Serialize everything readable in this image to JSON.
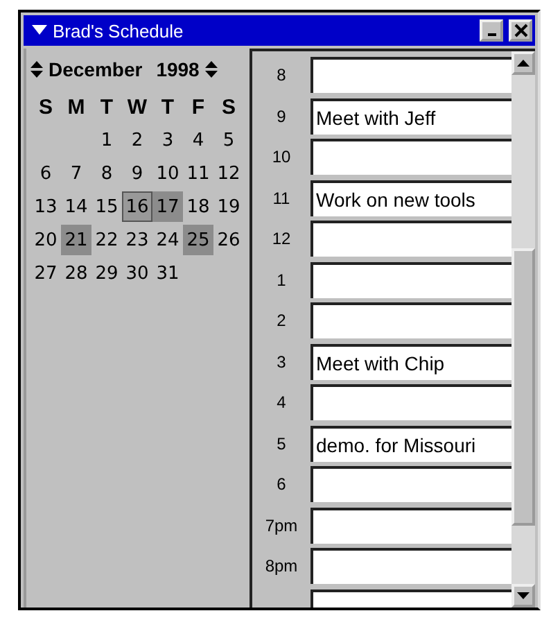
{
  "window": {
    "title": "Brad's Schedule"
  },
  "calendar": {
    "month": "December",
    "year": "1998",
    "weekdays": [
      "S",
      "M",
      "T",
      "W",
      "T",
      "F",
      "S"
    ],
    "days": [
      {
        "label": "1",
        "selected": false,
        "highlighted": false
      },
      {
        "label": "2",
        "selected": false,
        "highlighted": false
      },
      {
        "label": "3",
        "selected": false,
        "highlighted": false
      },
      {
        "label": "4",
        "selected": false,
        "highlighted": false
      },
      {
        "label": "5",
        "selected": false,
        "highlighted": false
      },
      {
        "label": "6",
        "selected": false,
        "highlighted": false
      },
      {
        "label": "7",
        "selected": false,
        "highlighted": false
      },
      {
        "label": "8",
        "selected": false,
        "highlighted": false
      },
      {
        "label": "9",
        "selected": false,
        "highlighted": false
      },
      {
        "label": "10",
        "selected": false,
        "highlighted": false
      },
      {
        "label": "11",
        "selected": false,
        "highlighted": false
      },
      {
        "label": "12",
        "selected": false,
        "highlighted": false
      },
      {
        "label": "13",
        "selected": false,
        "highlighted": false
      },
      {
        "label": "14",
        "selected": false,
        "highlighted": false
      },
      {
        "label": "15",
        "selected": false,
        "highlighted": false
      },
      {
        "label": "16",
        "selected": true,
        "highlighted": true
      },
      {
        "label": "17",
        "selected": false,
        "highlighted": true
      },
      {
        "label": "18",
        "selected": false,
        "highlighted": false
      },
      {
        "label": "19",
        "selected": false,
        "highlighted": false
      },
      {
        "label": "20",
        "selected": false,
        "highlighted": false
      },
      {
        "label": "21",
        "selected": false,
        "highlighted": true
      },
      {
        "label": "22",
        "selected": false,
        "highlighted": false
      },
      {
        "label": "23",
        "selected": false,
        "highlighted": false
      },
      {
        "label": "24",
        "selected": false,
        "highlighted": false
      },
      {
        "label": "25",
        "selected": false,
        "highlighted": true
      },
      {
        "label": "26",
        "selected": false,
        "highlighted": false
      },
      {
        "label": "27",
        "selected": false,
        "highlighted": false
      },
      {
        "label": "28",
        "selected": false,
        "highlighted": false
      },
      {
        "label": "29",
        "selected": false,
        "highlighted": false
      },
      {
        "label": "30",
        "selected": false,
        "highlighted": false
      },
      {
        "label": "31",
        "selected": false,
        "highlighted": false
      }
    ]
  },
  "schedule": [
    {
      "hour": "8"
    },
    {
      "hour": "9",
      "value": "Meet with Jeff"
    },
    {
      "hour": "10"
    },
    {
      "hour": "11",
      "value": "Work on new tools"
    },
    {
      "hour": "12"
    },
    {
      "hour": "1"
    },
    {
      "hour": "2"
    },
    {
      "hour": "3",
      "value": "Meet with Chip"
    },
    {
      "hour": "4"
    },
    {
      "hour": "5",
      "value": "demo. for Missouri"
    },
    {
      "hour": "6"
    },
    {
      "hour": "7pm"
    },
    {
      "hour": "8pm"
    }
  ]
}
